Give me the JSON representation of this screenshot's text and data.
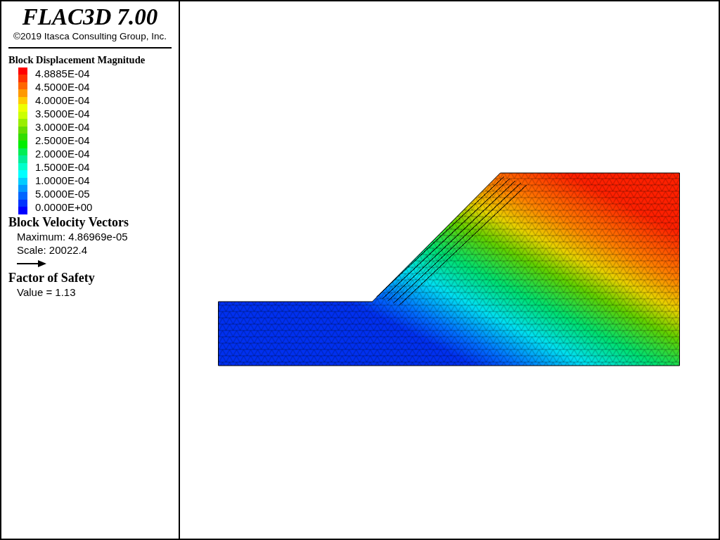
{
  "title": "FLAC3D 7.00",
  "copyright": "©2019 Itasca Consulting Group, Inc.",
  "contour_legend": {
    "title": "Block Displacement Magnitude",
    "bands": [
      {
        "color": "#ff0000"
      },
      {
        "color": "#ff3300"
      },
      {
        "color": "#ff6600"
      },
      {
        "color": "#ff9900"
      },
      {
        "color": "#ffcc00"
      },
      {
        "color": "#eeff00"
      },
      {
        "color": "#ccff00"
      },
      {
        "color": "#99ee00"
      },
      {
        "color": "#66dd00"
      },
      {
        "color": "#33dd00"
      },
      {
        "color": "#00ee00"
      },
      {
        "color": "#00ee55"
      },
      {
        "color": "#00ee99"
      },
      {
        "color": "#00ffcc"
      },
      {
        "color": "#00ffff"
      },
      {
        "color": "#00ccff"
      },
      {
        "color": "#0099ff"
      },
      {
        "color": "#0066ff"
      },
      {
        "color": "#0033ff"
      },
      {
        "color": "#0000ff"
      }
    ],
    "labels": [
      "4.8885E-04",
      "4.5000E-04",
      "4.0000E-04",
      "3.5000E-04",
      "3.0000E-04",
      "2.5000E-04",
      "2.0000E-04",
      "1.5000E-04",
      "1.0000E-04",
      "5.0000E-05",
      "0.0000E+00"
    ]
  },
  "vector_legend": {
    "title": "Block Velocity Vectors",
    "maximum": "Maximum: 4.86969e-05",
    "scale": "Scale: 20022.4"
  },
  "safety": {
    "title": "Factor of Safety",
    "value": "Value = 1.13"
  }
}
